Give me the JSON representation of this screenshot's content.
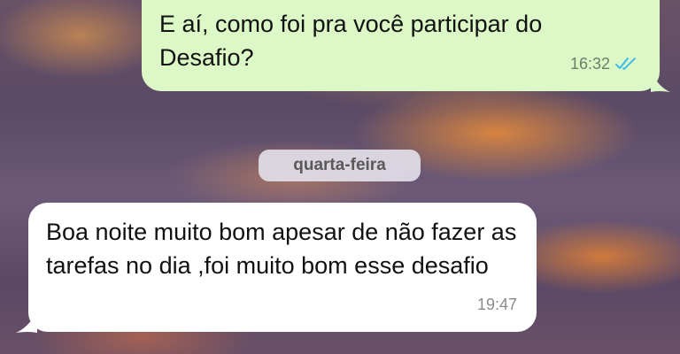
{
  "messages": [
    {
      "direction": "outgoing",
      "text": "E aí, como foi pra você participar do Desafio?",
      "time": "16:32",
      "status_icon": "double-check-read-icon",
      "status_color": "#34b7f1"
    },
    {
      "direction": "incoming",
      "text": "Boa noite  muito bom apesar de não fazer as tarefas no dia ,foi muito  bom esse desafio",
      "time": "19:47"
    }
  ],
  "date_separator": "quarta-feira",
  "colors": {
    "outgoing_bubble": "#dbf8c6",
    "incoming_bubble": "#ffffff",
    "date_chip": "#e2dee8"
  }
}
